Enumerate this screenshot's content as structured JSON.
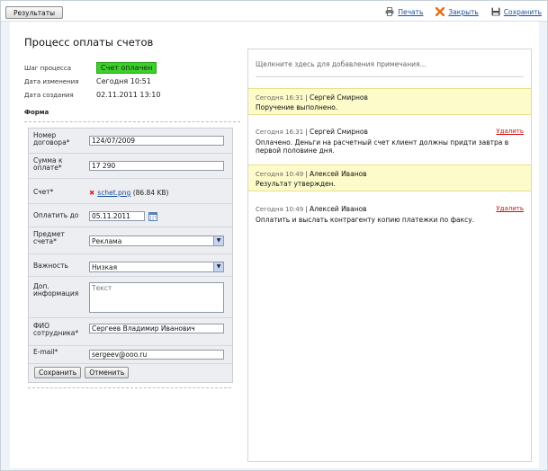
{
  "toolbar": {
    "results_label": "Результаты",
    "print_label": "Печать",
    "close_label": "Закрыть",
    "save_label": "Сохранить",
    "print_icon": "printer-icon",
    "close_icon": "close-x-icon",
    "save_icon": "floppy-disk-icon"
  },
  "page": {
    "title": "Процесс оплаты счетов"
  },
  "meta": {
    "step_label": "Шаг процесса",
    "step_value": "Счет оплачен",
    "changed_label": "Дата изменения",
    "changed_value": "Сегодня 10:51",
    "created_label": "Дата создания",
    "created_value": "02.11.2011 13:10",
    "status_color": "#3bd12a"
  },
  "form": {
    "heading": "Форма",
    "contract_label": "Номер договора*",
    "contract_value": "124/07/2009",
    "amount_label": "Сумма к оплате*",
    "amount_value": "17 290",
    "invoice_label": "Счет*",
    "invoice_file": "schet.png",
    "invoice_size": "(86.84 KB)",
    "pay_by_label": "Оплатить до",
    "pay_by_value": "05.11.2011",
    "subject_label": "Предмет счета*",
    "subject_value": "Реклама",
    "priority_label": "Важность",
    "priority_value": "Низкая",
    "info_label": "Доп. информация",
    "info_placeholder": "Текст",
    "employee_label": "ФИО сотрудника*",
    "employee_value": "Сергеев Владимир Иванович",
    "email_label": "E-mail*",
    "email_value": "sergeev@ooo.ru",
    "save_button": "Сохранить",
    "cancel_button": "Отменить"
  },
  "notes": {
    "placeholder": "Щелкните здесь для добавления примечания...",
    "delete_label": "Удалить",
    "items": [
      {
        "time": "Сегодня 16:31",
        "author": "Сергей Смирнов",
        "text": "Поручение выполнено.",
        "highlight": true
      },
      {
        "time": "Сегодня 16:31",
        "author": "Сергей Смирнов",
        "text": "Оплачено. Деньги на расчетный счет клиент должны придти завтра в первой половине дня.",
        "highlight": false
      },
      {
        "time": "Сегодня 10:49",
        "author": "Алексей Иванов",
        "text": "Результат утвержден.",
        "highlight": true
      },
      {
        "time": "Сегодня 10:49",
        "author": "Алексей Иванов",
        "text": "Оплатить и выслать контрагенту копию платежки по факсу.",
        "highlight": false
      }
    ]
  }
}
